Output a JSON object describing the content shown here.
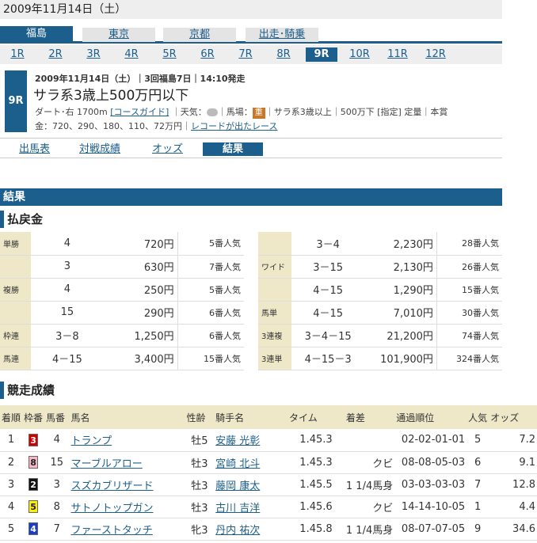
{
  "date_header": "2009年11月14日（土）",
  "venues": [
    {
      "label": "福島",
      "active": true
    },
    {
      "label": "東京",
      "active": false
    },
    {
      "label": "京都",
      "active": false
    },
    {
      "label": "出走･騎乗",
      "active": false
    }
  ],
  "races": [
    "1R",
    "2R",
    "3R",
    "4R",
    "5R",
    "6R",
    "7R",
    "8R",
    "9R",
    "10R",
    "11R",
    "12R"
  ],
  "race": {
    "badge": "9R",
    "meta": "2009年11月14日（土）｜3回福島7日｜14:10発走",
    "name": "サラ系3歳上500万円以下",
    "course_prefix": "ダート･右 1700m",
    "course_guide": "[コースガイド]",
    "weather_label": "｜天気：",
    "track_label": "｜馬場：",
    "track_condition": "重",
    "conditions": "｜サラ系3歳以上｜500万下 [指定] 定量｜本賞",
    "prize": "金：720、290、180、110、72万円｜",
    "record_link": "レコードが出たレース"
  },
  "subtabs": [
    "出馬表",
    "対戦成績",
    "オッズ",
    "結果"
  ],
  "section_title": "結果",
  "payout_title": "払戻金",
  "payouts_left": [
    {
      "label": "単勝",
      "num": "4",
      "amount": "720円",
      "pop": "5番人気"
    },
    {
      "label": "",
      "num": "3",
      "amount": "630円",
      "pop": "7番人気"
    },
    {
      "label": "複勝",
      "num": "4",
      "amount": "250円",
      "pop": "5番人気"
    },
    {
      "label": "",
      "num": "15",
      "amount": "290円",
      "pop": "6番人気"
    },
    {
      "label": "枠連",
      "num": "3－8",
      "amount": "1,250円",
      "pop": "6番人気"
    },
    {
      "label": "馬連",
      "num": "4－15",
      "amount": "3,400円",
      "pop": "15番人気"
    }
  ],
  "payouts_right": [
    {
      "label": "",
      "num": "3－4",
      "amount": "2,230円",
      "pop": "28番人気"
    },
    {
      "label": "ワイド",
      "num": "3－15",
      "amount": "2,130円",
      "pop": "26番人気"
    },
    {
      "label": "",
      "num": "4－15",
      "amount": "1,290円",
      "pop": "15番人気"
    },
    {
      "label": "馬単",
      "num": "4－15",
      "amount": "7,010円",
      "pop": "30番人気"
    },
    {
      "label": "3連複",
      "num": "3－4－15",
      "amount": "21,200円",
      "pop": "74番人気"
    },
    {
      "label": "3連単",
      "num": "4－15－3",
      "amount": "101,900円",
      "pop": "324番人気"
    }
  ],
  "results_title": "競走成績",
  "result_headers": [
    "着順",
    "枠番",
    "馬番",
    "馬名",
    "性齢",
    "騎手名",
    "タイム",
    "着差",
    "通過順位",
    "人気",
    "オッズ"
  ],
  "results": [
    {
      "pos": "1",
      "waku": "3",
      "waku_bg": "#d00000",
      "waku_fg": "#ffffff",
      "num": "4",
      "horse": "トランプ",
      "sexage": "牡5",
      "jockey": "安藤 光彰",
      "time": "1.45.3",
      "margin": "",
      "passing": "02-02-01-01",
      "pop": "5",
      "odds": "7.2"
    },
    {
      "pos": "2",
      "waku": "8",
      "waku_bg": "#f4b6c8",
      "waku_fg": "#222222",
      "num": "15",
      "horse": "マーブルアロー",
      "sexage": "牡3",
      "jockey": "宮崎 北斗",
      "time": "1.45.3",
      "margin": "クビ",
      "passing": "08-08-05-03",
      "pop": "6",
      "odds": "9.1"
    },
    {
      "pos": "3",
      "waku": "2",
      "waku_bg": "#111111",
      "waku_fg": "#ffffff",
      "num": "3",
      "horse": "スズカブリザード",
      "sexage": "牡3",
      "jockey": "藤岡 康太",
      "time": "1.45.5",
      "margin": "1 1/4馬身",
      "passing": "03-03-03-03",
      "pop": "7",
      "odds": "12.8"
    },
    {
      "pos": "4",
      "waku": "5",
      "waku_bg": "#ffee00",
      "waku_fg": "#222222",
      "num": "8",
      "horse": "サトノトップガン",
      "sexage": "牡3",
      "jockey": "古川 吉洋",
      "time": "1.45.6",
      "margin": "クビ",
      "passing": "14-14-10-05",
      "pop": "1",
      "odds": "4.4"
    },
    {
      "pos": "5",
      "waku": "4",
      "waku_bg": "#1a3cc8",
      "waku_fg": "#ffffff",
      "num": "7",
      "horse": "ファーストタッチ",
      "sexage": "牝3",
      "jockey": "丹内 祐次",
      "time": "1.45.8",
      "margin": "1 1/4馬身",
      "passing": "08-07-07-05",
      "pop": "9",
      "odds": "34.6"
    }
  ]
}
